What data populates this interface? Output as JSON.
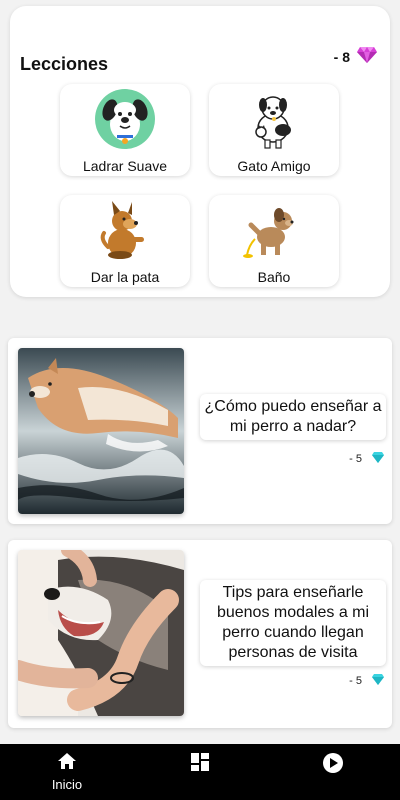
{
  "lessons": {
    "title": "Lecciones",
    "gems": "- 8",
    "gem_color": "#d63fd6",
    "items": [
      {
        "label": "Ladrar Suave",
        "icon": "barking-dog-icon"
      },
      {
        "label": "Gato Amigo",
        "icon": "dog-and-cat-icon"
      },
      {
        "label": "Dar la pata",
        "icon": "sitting-dog-icon"
      },
      {
        "label": "Baño",
        "icon": "peeing-dog-icon"
      }
    ]
  },
  "articles": [
    {
      "title": "¿Cómo puedo enseñar a mi perro a nadar?",
      "cost": "- 5",
      "image": "swimming-dog-photo"
    },
    {
      "title": "Tips para enseñarle buenos modales a mi perro cuando llegan personas de visita",
      "cost": "- 5",
      "image": "husky-petted-photo"
    }
  ],
  "cost_gem_color": "#39d3e0",
  "nav": {
    "items": [
      {
        "label": "Inicio",
        "icon": "home-icon"
      },
      {
        "label": "",
        "icon": "dashboard-icon"
      },
      {
        "label": "",
        "icon": "play-icon"
      }
    ]
  }
}
